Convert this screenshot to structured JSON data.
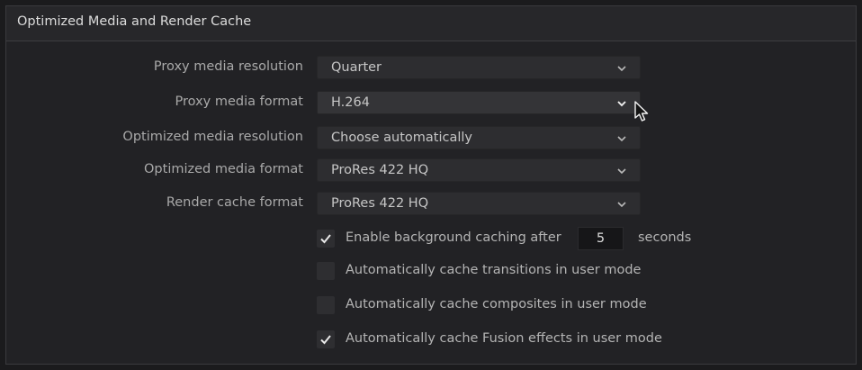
{
  "panel": {
    "title": "Optimized Media and Render Cache"
  },
  "settings": [
    {
      "label": "Proxy media resolution",
      "value": "Quarter"
    },
    {
      "label": "Proxy media format",
      "value": "H.264"
    },
    {
      "label": "Optimized media resolution",
      "value": "Choose automatically"
    },
    {
      "label": "Optimized media format",
      "value": "ProRes 422 HQ"
    },
    {
      "label": "Render cache format",
      "value": "ProRes 422 HQ"
    }
  ],
  "background_caching": {
    "label": "Enable background caching after",
    "checked": true,
    "seconds_value": "5",
    "seconds_unit": "seconds"
  },
  "options": [
    {
      "label": "Automatically cache transitions in user mode",
      "checked": false
    },
    {
      "label": "Automatically cache composites in user mode",
      "checked": false
    },
    {
      "label": "Automatically cache Fusion effects in user mode",
      "checked": true
    }
  ],
  "icons": {
    "dropdown": "chevron-down-icon",
    "check": "checkmark-icon",
    "cursor": "mouse-pointer-icon"
  }
}
